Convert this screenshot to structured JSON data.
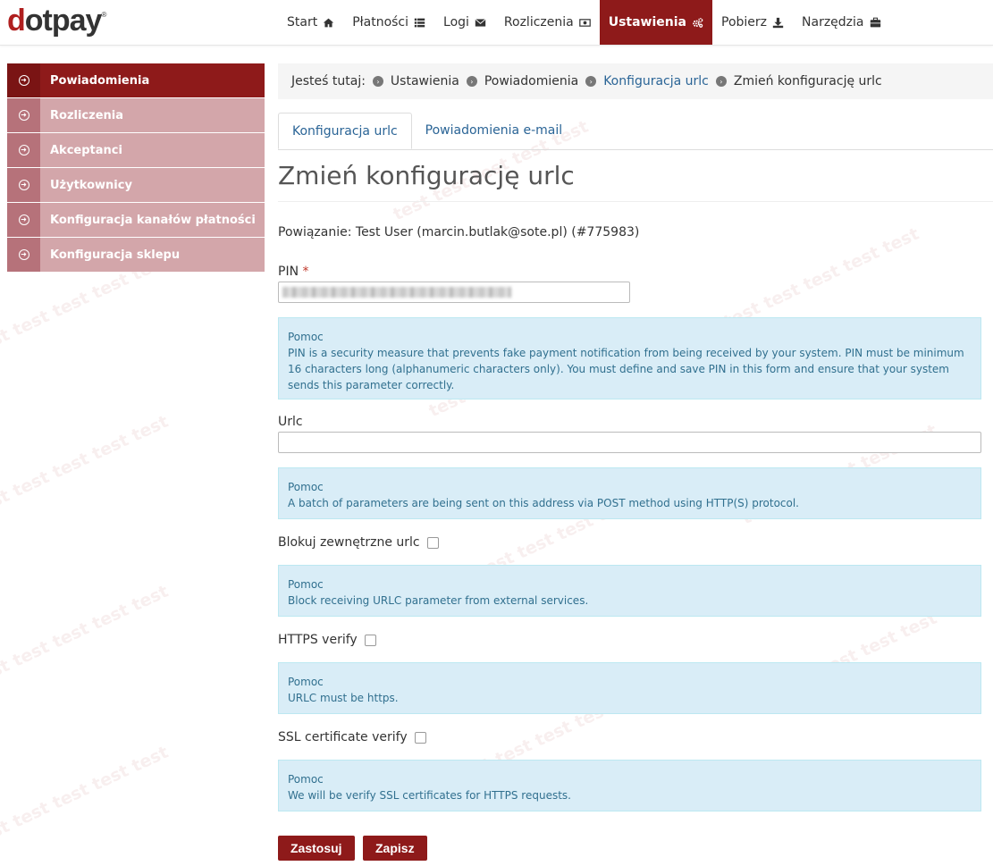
{
  "header": {
    "logo": "dotpay",
    "logo_mark": "®",
    "nav": [
      {
        "label": "Start",
        "icon": "home-icon"
      },
      {
        "label": "Płatności",
        "icon": "list-icon"
      },
      {
        "label": "Logi",
        "icon": "envelope-icon"
      },
      {
        "label": "Rozliczenia",
        "icon": "money-icon"
      },
      {
        "label": "Ustawienia",
        "icon": "cogs-icon",
        "active": true
      },
      {
        "label": "Pobierz",
        "icon": "download-icon"
      },
      {
        "label": "Narzędzia",
        "icon": "briefcase-icon"
      }
    ]
  },
  "sidebar": {
    "items": [
      {
        "label": "Powiadomienia",
        "active": true
      },
      {
        "label": "Rozliczenia"
      },
      {
        "label": "Akceptanci"
      },
      {
        "label": "Użytkownicy"
      },
      {
        "label": "Konfiguracja kanałów płatności"
      },
      {
        "label": "Konfiguracja sklepu"
      }
    ]
  },
  "breadcrumb": {
    "prefix": "Jesteś tutaj:",
    "items": [
      "Ustawienia",
      "Powiadomienia",
      "Konfiguracja urlc",
      "Zmień konfigurację urlc"
    ]
  },
  "tabs": [
    {
      "label": "Konfiguracja urlc",
      "active": true
    },
    {
      "label": "Powiadomienia e-mail"
    }
  ],
  "page": {
    "title": "Zmień konfigurację urlc",
    "binding": "Powiązanie: Test User (marcin.butlak@sote.pl) (#775983)"
  },
  "form": {
    "pin_label": "PIN",
    "pin_required": "*",
    "urlc_label": "Urlc",
    "urlc_value": "",
    "block_label": "Blokuj zewnętrzne urlc",
    "https_label": "HTTPS verify",
    "ssl_label": "SSL certificate verify",
    "help_title": "Pomoc",
    "help_pin": "PIN is a security measure that prevents fake payment notification from being received by your system. PIN must be minimum 16 characters long (alphanumeric characters only). You must define and save PIN in this form and ensure that your system sends this parameter correctly.",
    "help_urlc": "A batch of parameters are being sent on this address via POST method using HTTP(S) protocol.",
    "help_block": "Block receiving URLC parameter from external services.",
    "help_https": "URLC must be https.",
    "help_ssl": "We will be verify SSL certificates for HTTPS requests.",
    "apply_button": "Zastosuj",
    "save_button": "Zapisz"
  },
  "watermark": "test test test test test",
  "colors": {
    "accent": "#8e1a1a",
    "sidebar_inactive": "#d3a6aa",
    "help_bg": "#d9edf7",
    "link": "#2a6496"
  }
}
